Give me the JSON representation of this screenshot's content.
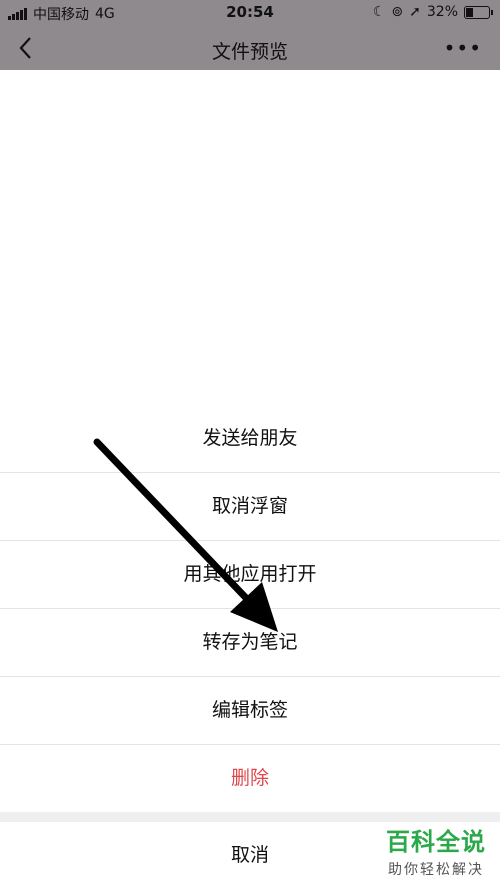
{
  "status_bar": {
    "carrier": "中国移动",
    "network": "4G",
    "time": "20:54",
    "battery": "32%",
    "icons": [
      "signal-icon",
      "moon-icon",
      "lock-rotation-icon",
      "location-icon",
      "battery-icon"
    ]
  },
  "navbar": {
    "title": "文件预览",
    "more": "•••"
  },
  "action_sheet": {
    "items": [
      {
        "label": "发送给朋友"
      },
      {
        "label": "取消浮窗"
      },
      {
        "label": "用其他应用打开"
      },
      {
        "label": "转存为笔记"
      },
      {
        "label": "编辑标签"
      },
      {
        "label": "删除"
      }
    ],
    "cancel": "取消"
  },
  "watermark": {
    "title": "百科全说",
    "subtitle": "助你轻松解决"
  },
  "colors": {
    "dim_background": "#8e8a8e",
    "danger": "#e0474a",
    "watermark_green": "#2aa84a"
  }
}
